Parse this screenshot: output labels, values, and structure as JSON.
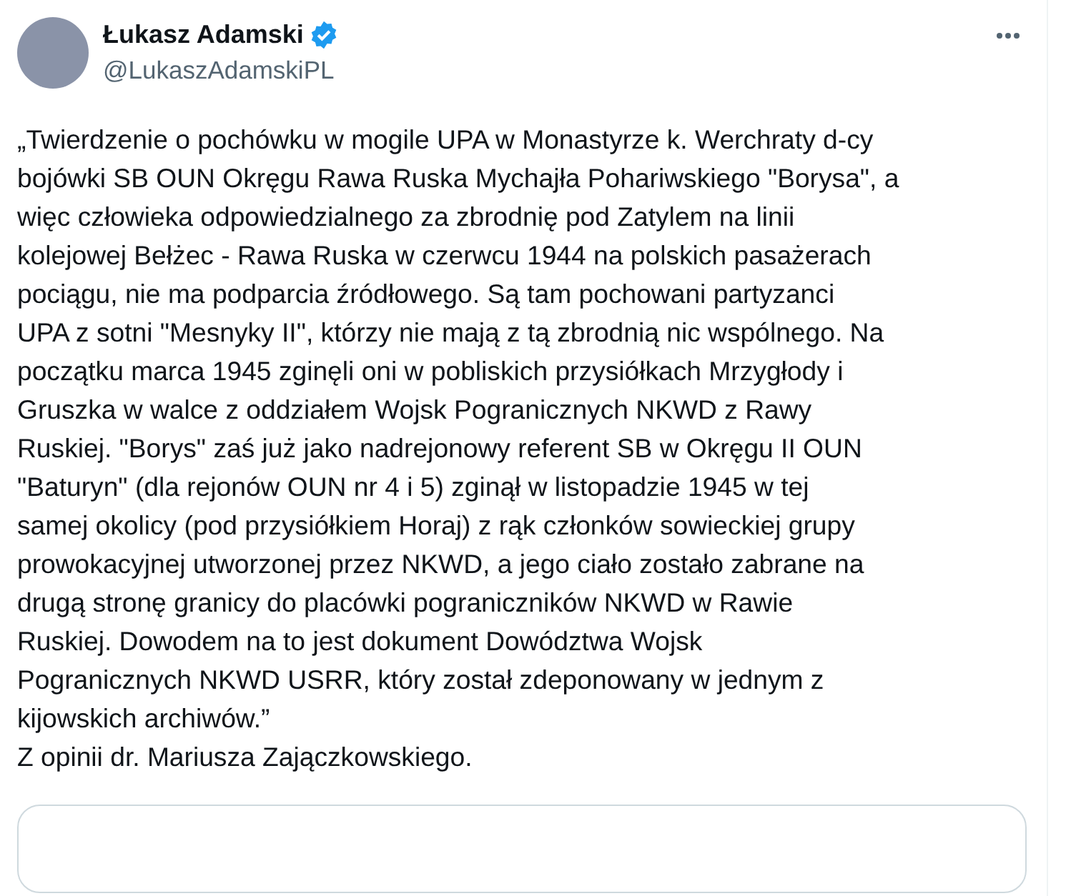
{
  "author": {
    "name": "Łukasz Adamski",
    "verified": true,
    "handle": "@LukaszAdamskiPL"
  },
  "tweet": {
    "text": "„Twierdzenie o pochówku w mogile UPA w Monastyrze k. Werchraty d-cy\nbojówki SB OUN Okręgu Rawa Ruska Mychajła Pohariwskiego \"Borysa\", a\nwięc człowieka odpowiedzialnego za zbrodnię pod Zatylem na linii\nkolejowej Bełżec - Rawa Ruska w czerwcu 1944 na polskich pasażerach\npociągu, nie ma podparcia źródłowego. Są tam pochowani partyzanci\nUPA z sotni \"Mesnyky II\", którzy nie mają z tą zbrodnią nic wspólnego. Na\npoczątku marca 1945 zginęli oni w pobliskich przysiółkach Mrzygłody i\nGruszka w walce z oddziałem Wojsk Pogranicznych NKWD z Rawy\nRuskiej. \"Borys\" zaś już jako nadrejonowy referent SB w Okręgu II OUN\n\"Baturyn\" (dla rejonów OUN nr 4 i 5) zginął w listopadzie 1945 w tej\nsamej okolicy (pod przysiółkiem Horaj) z rąk członków sowieckiej grupy\nprowokacyjnej utworzonej przez NKWD, a jego ciało zostało zabrane na\ndrugą stronę granicy do placówki pograniczników NKWD w Rawie\nRuskiej. Dowodem na to jest dokument Dowództwa Wojsk\nPogranicznych NKWD USRR, który został zdeponowany w jednym z\nkijowskich archiwów.”",
    "attribution": "Z opinii dr. Mariusza Zajączkowskiego."
  }
}
